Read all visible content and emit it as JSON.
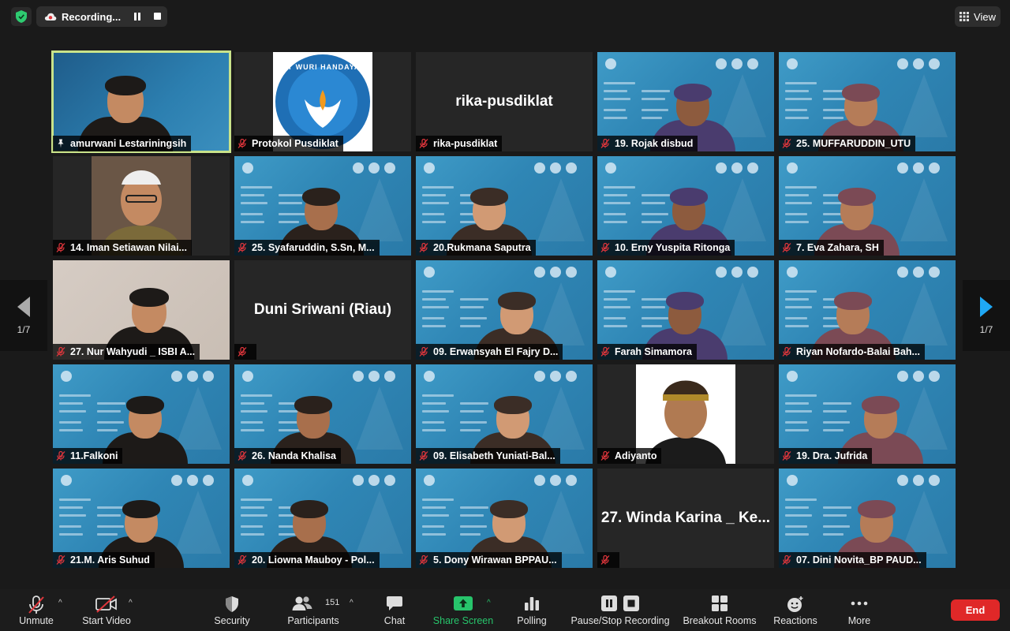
{
  "recording": {
    "label": "Recording..."
  },
  "view_label": "View",
  "page_indicator": "1/7",
  "participants": [
    {
      "name": "amurwani Lestariningsih",
      "kind": "speaker",
      "active": true,
      "pin": true
    },
    {
      "name": "Protokol Pusdiklat",
      "kind": "logo",
      "logo_text": "TUT WURI HANDAYANI"
    },
    {
      "name": "rika-pusdiklat",
      "kind": "name"
    },
    {
      "name": "19. Rojak disbud",
      "kind": "slide"
    },
    {
      "name": "25. MUFFARUDDIN_UTU",
      "kind": "slide"
    },
    {
      "name": "14. Iman Setiawan Nilai...",
      "kind": "photo"
    },
    {
      "name": "25. Syafaruddin, S.Sn, M...",
      "kind": "slide"
    },
    {
      "name": "20.Rukmana Saputra",
      "kind": "slide"
    },
    {
      "name": "10. Erny Yuspita Ritonga",
      "kind": "slide"
    },
    {
      "name": "7. Eva Zahara, SH",
      "kind": "slide"
    },
    {
      "name": "27. Nur Wahyudi _ ISBI A...",
      "kind": "wall"
    },
    {
      "name": "",
      "kind": "name",
      "display": "Duni Sriwani (Riau)"
    },
    {
      "name": "09. Erwansyah El Fajry D...",
      "kind": "slide"
    },
    {
      "name": "Farah Simamora",
      "kind": "slide"
    },
    {
      "name": "Riyan Nofardo-Balai Bah...",
      "kind": "slide"
    },
    {
      "name": "11.Falkoni",
      "kind": "slide"
    },
    {
      "name": "26. Nanda Khalisa",
      "kind": "slide"
    },
    {
      "name": "09. Elisabeth Yuniati-Bal...",
      "kind": "slide"
    },
    {
      "name": "Adiyanto",
      "kind": "photo-white"
    },
    {
      "name": "19. Dra. Jufrida",
      "kind": "slide"
    },
    {
      "name": "21.M. Aris Suhud",
      "kind": "slide"
    },
    {
      "name": "20. Liowna Mauboy - Pol...",
      "kind": "slide"
    },
    {
      "name": "5. Dony Wirawan BPPAU...",
      "kind": "slide"
    },
    {
      "name": "",
      "kind": "name",
      "display": "27. Winda Karina _ Ke..."
    },
    {
      "name": "07. Dini Novita_BP PAUD...",
      "kind": "slide"
    }
  ],
  "toolbar": {
    "unmute": "Unmute",
    "start_video": "Start Video",
    "security": "Security",
    "participants": "Participants",
    "participants_count": "151",
    "chat": "Chat",
    "share_screen": "Share Screen",
    "polling": "Polling",
    "pause_stop_recording": "Pause/Stop Recording",
    "breakout_rooms": "Breakout Rooms",
    "reactions": "Reactions",
    "more": "More",
    "end": "End"
  },
  "colors": {
    "accent_green": "#27c46b",
    "active_border": "#c9e38a",
    "end_red": "#e02828",
    "muted_red": "#e0363c"
  }
}
